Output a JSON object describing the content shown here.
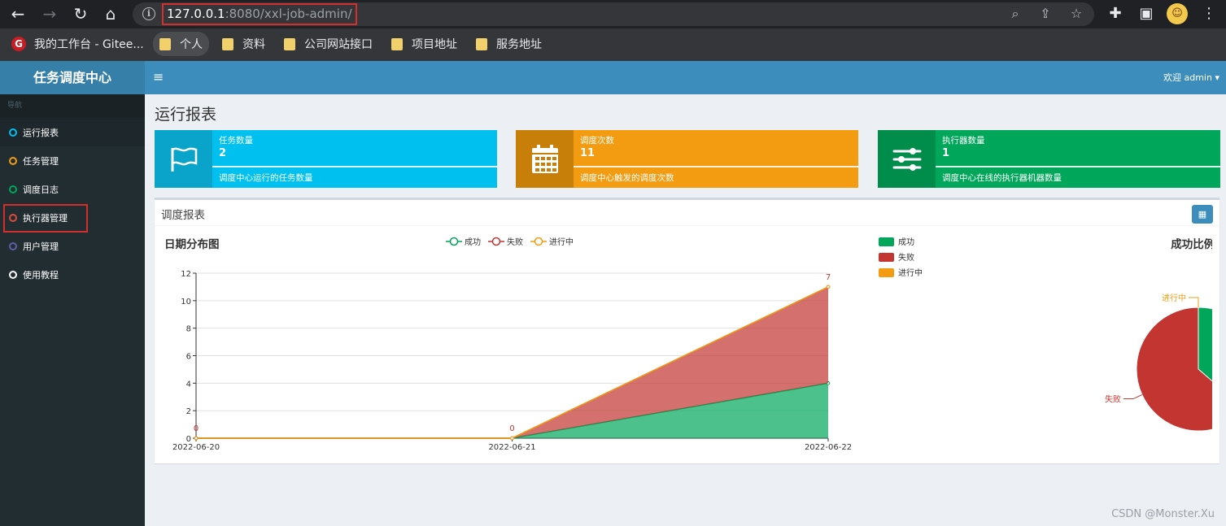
{
  "browser": {
    "url_host": "127.0.0.1",
    "url_rest": ":8080/xxl-job-admin/",
    "bookmarks": [
      {
        "label": "我的工作台 - Gitee..."
      },
      {
        "label": "个人"
      },
      {
        "label": "资料"
      },
      {
        "label": "公司网站接口"
      },
      {
        "label": "项目地址"
      },
      {
        "label": "服务地址"
      }
    ]
  },
  "sidebar": {
    "brand": "任务调度中心",
    "nav_header": "导航",
    "items": [
      {
        "label": "运行报表",
        "color": "#00c0ef"
      },
      {
        "label": "任务管理",
        "color": "#f39c12"
      },
      {
        "label": "调度日志",
        "color": "#00a65a"
      },
      {
        "label": "执行器管理",
        "color": "#dd4b39"
      },
      {
        "label": "用户管理",
        "color": "#605ca8"
      },
      {
        "label": "使用教程",
        "color": "#ffffff"
      }
    ]
  },
  "header": {
    "welcome": "欢迎 admin"
  },
  "page": {
    "title": "运行报表"
  },
  "info_boxes": [
    {
      "label": "任务数量",
      "number": "2",
      "desc": "调度中心运行的任务数量",
      "color": "#00c0ef",
      "icon_bg": "#0aa3c9",
      "icon": "flag-icon"
    },
    {
      "label": "调度次数",
      "number": "11",
      "desc": "调度中心触发的调度次数",
      "color": "#f39c12",
      "icon_bg": "#c87f0a",
      "icon": "calendar-icon"
    },
    {
      "label": "执行器数量",
      "number": "1",
      "desc": "调度中心在线的执行器机器数量",
      "color": "#00a65a",
      "icon_bg": "#008d4c",
      "icon": "sliders-icon"
    }
  ],
  "report": {
    "title": "调度报表"
  },
  "watermark": "CSDN @Monster.Xu",
  "chart_data": [
    {
      "type": "area",
      "title": "日期分布图",
      "stacked": true,
      "legend_position": "top-center",
      "categories": [
        "2022-06-20",
        "2022-06-21",
        "2022-06-22"
      ],
      "ylim": [
        0,
        12
      ],
      "yticks": [
        0,
        2,
        4,
        6,
        8,
        10,
        12
      ],
      "grid": true,
      "series": [
        {
          "name": "成功",
          "values": [
            0,
            0,
            4
          ],
          "color": "#00a65a"
        },
        {
          "name": "失败",
          "values": [
            0,
            0,
            7
          ],
          "color": "#c23531"
        },
        {
          "name": "进行中",
          "values": [
            0,
            0,
            0
          ],
          "color": "#f39c12"
        }
      ],
      "data_labels": [
        "0",
        "0",
        "7"
      ]
    },
    {
      "type": "pie",
      "title": "成功比例图",
      "legend_position": "top-left",
      "slices": [
        {
          "name": "成功",
          "value": 4,
          "color": "#00a65a"
        },
        {
          "name": "失败",
          "value": 7,
          "color": "#c23531"
        },
        {
          "name": "进行中",
          "value": 0,
          "color": "#f39c12"
        }
      ]
    }
  ]
}
